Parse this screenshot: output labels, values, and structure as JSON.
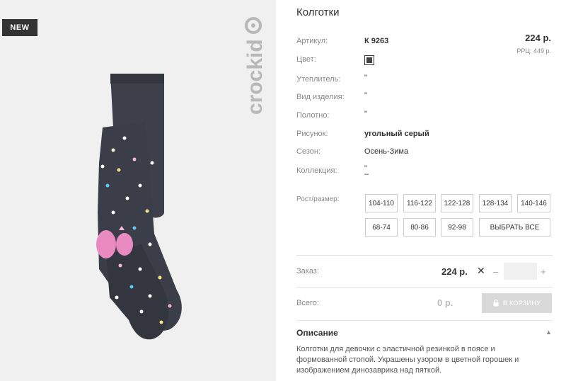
{
  "image": {
    "badge": "NEW",
    "brand": "crockid"
  },
  "product": {
    "title": "Колготки",
    "price": "224 р.",
    "rrp": "РРЦ: 449 р.",
    "swatch_color": "#444444",
    "attributes": [
      {
        "label": "Артикул:",
        "value": "К 9263"
      },
      {
        "label": "Цвет:",
        "value": ""
      },
      {
        "label": "Утеплитель:",
        "value": "\""
      },
      {
        "label": "Вид изделия:",
        "value": "\""
      },
      {
        "label": "Полотно:",
        "value": "\""
      },
      {
        "label": "Рисунок:",
        "value": "угольный серый"
      },
      {
        "label": "Сезон:",
        "value": "Осень-Зима"
      },
      {
        "label": "Коллекция:",
        "value": "\""
      }
    ],
    "collection_extra": "–"
  },
  "sizes": {
    "label": "Рост/размер:",
    "options": [
      "104-110",
      "116-122",
      "122-128",
      "128-134",
      "140-146",
      "68-74",
      "80-86",
      "92-98"
    ],
    "select_all": "ВЫБРАТЬ ВСЕ"
  },
  "order": {
    "label": "Заказ:",
    "price": "224 р.",
    "remove": "✕",
    "minus": "–",
    "plus": "+",
    "quantity": ""
  },
  "total": {
    "label": "Всего:",
    "price": "0 р.",
    "cart_button": "В КОРЗИНУ"
  },
  "description": {
    "heading": "Описание",
    "toggle": "▲",
    "text": "Колготки для девочки с эластичной резинкой в поясе и формованной стопой. Украшены узором в цветной горошек и изображением динозаврика над пяткой."
  }
}
